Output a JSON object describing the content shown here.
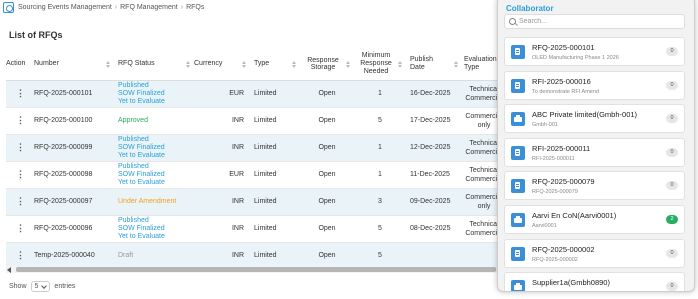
{
  "breadcrumb": [
    "Sourcing Events Management",
    "RFQ Management",
    "RFQs"
  ],
  "list_title": "List of RFQs",
  "columns": [
    "Action",
    "Number",
    "RFQ Status",
    "Currency",
    "Type",
    "Response Storage",
    "Minimum Response Needed",
    "Publish Date",
    "Evaluation Type"
  ],
  "rows": [
    {
      "number": "RFQ-2025-000101",
      "status": [
        "Published",
        "SOW Finalized",
        "Yet to Evaluate"
      ],
      "status_color": "blue",
      "currency": "EUR",
      "type": "Limited",
      "storage": "Open",
      "min": "1",
      "date": "16-Dec-2025",
      "eval": [
        "Technical",
        "Commercial"
      ]
    },
    {
      "number": "RFQ-2025-000100",
      "status": [
        "Approved"
      ],
      "status_color": "green",
      "currency": "INR",
      "type": "Limited",
      "storage": "Open",
      "min": "5",
      "date": "17-Dec-2025",
      "eval": [
        "Commercial",
        "only"
      ]
    },
    {
      "number": "RFQ-2025-000099",
      "status": [
        "Published",
        "SOW Finalized",
        "Yet to Evaluate"
      ],
      "status_color": "blue",
      "currency": "INR",
      "type": "Limited",
      "storage": "Open",
      "min": "1",
      "date": "12-Dec-2025",
      "eval": [
        "Technical",
        "Commercial"
      ]
    },
    {
      "number": "RFQ-2025-000098",
      "status": [
        "Published",
        "SOW Finalized",
        "Yet to Evaluate"
      ],
      "status_color": "blue",
      "currency": "EUR",
      "type": "Limited",
      "storage": "Open",
      "min": "1",
      "date": "11-Dec-2025",
      "eval": [
        "Technical",
        "Commercial"
      ]
    },
    {
      "number": "RFQ-2025-000097",
      "status": [
        "Under Amendment"
      ],
      "status_color": "orange",
      "currency": "INR",
      "type": "Limited",
      "storage": "Open",
      "min": "3",
      "date": "09-Dec-2025",
      "eval": [
        "Commercial",
        "only"
      ]
    },
    {
      "number": "RFQ-2025-000096",
      "status": [
        "Published",
        "SOW Finalized",
        "Yet to Evaluate"
      ],
      "status_color": "blue",
      "currency": "INR",
      "type": "Limited",
      "storage": "Open",
      "min": "5",
      "date": "08-Dec-2025",
      "eval": [
        "Technical",
        "Commercial"
      ]
    },
    {
      "number": "Temp-2025-000040",
      "status": [
        "Draft"
      ],
      "status_color": "gray",
      "currency": "INR",
      "type": "Limited",
      "storage": "Open",
      "min": "5",
      "date": "",
      "eval": [
        ""
      ]
    }
  ],
  "footer": {
    "show_label": "Show",
    "page_size": "5",
    "entries_label": "entries"
  },
  "collaborator": {
    "title": "Collaborator",
    "search_placeholder": "Search...",
    "items": [
      {
        "name": "RFQ-2025-000101",
        "sub": "OLED Manufacturing Phase 1 2026",
        "count": "0",
        "icon": "document-icon",
        "highlight": false
      },
      {
        "name": "RFI-2025-000016",
        "sub": "To demonstrate RFI Amend",
        "count": "0",
        "icon": "document-icon",
        "highlight": false
      },
      {
        "name": "ABC Private limited(Gmbh-001)",
        "sub": "Gmbh-001",
        "count": "0",
        "icon": "organization-icon",
        "highlight": false
      },
      {
        "name": "RFI-2025-000011",
        "sub": "RFI-2025-000011",
        "count": "0",
        "icon": "document-icon",
        "highlight": false
      },
      {
        "name": "RFQ-2025-000079",
        "sub": "RFQ-2025-000079",
        "count": "0",
        "icon": "document-icon",
        "highlight": false
      },
      {
        "name": "Aarvi En CoN(Aarvi0001)",
        "sub": "Aarvi0001",
        "count": "2",
        "icon": "organization-icon",
        "highlight": true
      },
      {
        "name": "RFQ-2025-000002",
        "sub": "RFQ-2025-000002",
        "count": "0",
        "icon": "document-icon",
        "highlight": false
      },
      {
        "name": "Supplier1a(Gmbh0890)",
        "sub": "",
        "count": "0",
        "icon": "organization-icon",
        "highlight": false
      }
    ]
  },
  "colors": {
    "accent": "#2a9fd6",
    "approved": "#27ae60",
    "amendment": "#f0a020",
    "row_alt": "#eaf4f8"
  }
}
